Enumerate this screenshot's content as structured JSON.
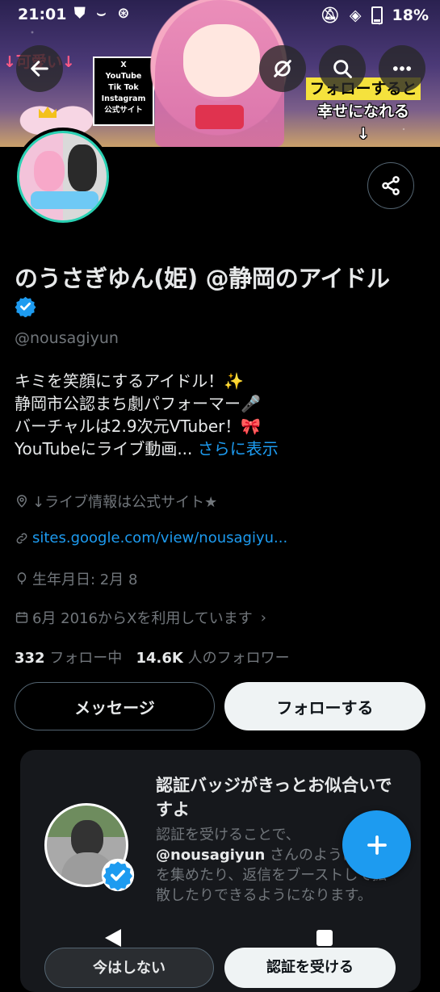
{
  "status_bar": {
    "time": "21:01",
    "battery": "18%",
    "icons": [
      "shield-check-icon",
      "amazon-icon",
      "vpn-icon",
      "mute-icon",
      "wifi-icon",
      "battery-icon"
    ]
  },
  "banner": {
    "left_text": "↓可愛い↓",
    "sign_lines": [
      "X",
      "YouTube",
      "Tik Tok",
      "Instagram",
      "公式サイト"
    ],
    "right_line1": "フォローすると",
    "right_line2": "幸せになれる",
    "right_arrow": "↓"
  },
  "header_buttons": [
    "back-icon",
    "grok-icon",
    "search-icon",
    "more-icon"
  ],
  "profile": {
    "display_name": "のうさぎゆん(姫) @静岡のアイドル",
    "verified": true,
    "handle": "@nousagiyun",
    "bio_lines": [
      "キミを笑顔にするアイドル！✨",
      "静岡市公認まち劇パフォーマー🎤",
      "バーチャルは2.9次元VTuber！🎀",
      "YouTubeにライブ動画..."
    ],
    "show_more": "さらに表示",
    "location": "↓ライブ情報は公式サイト★",
    "website": "sites.google.com/view/nousagiyu...",
    "birthday": "生年月日: 2月 8",
    "joined": "6月 2016からXを利用しています",
    "following_count": "332",
    "following_label": "フォロー中",
    "followers_count": "14.6K",
    "followers_label": "人のフォロワー"
  },
  "actions": {
    "message": "メッセージ",
    "follow": "フォローする"
  },
  "verify_card": {
    "title": "認証バッジがきっとお似合いですよ",
    "text_1": "認証を受けることで、",
    "text_handle": "@nousagiyun",
    "text_2": " さんのように注目を集めたり、返信をブーストして拡散したりできるようになります。",
    "dismiss": "今はしない",
    "get_verified": "認証を受ける"
  },
  "colors": {
    "accent": "#1d9bf0",
    "background": "#000000",
    "muted": "#71767b",
    "avatar_ring": "#2ad1b3"
  }
}
